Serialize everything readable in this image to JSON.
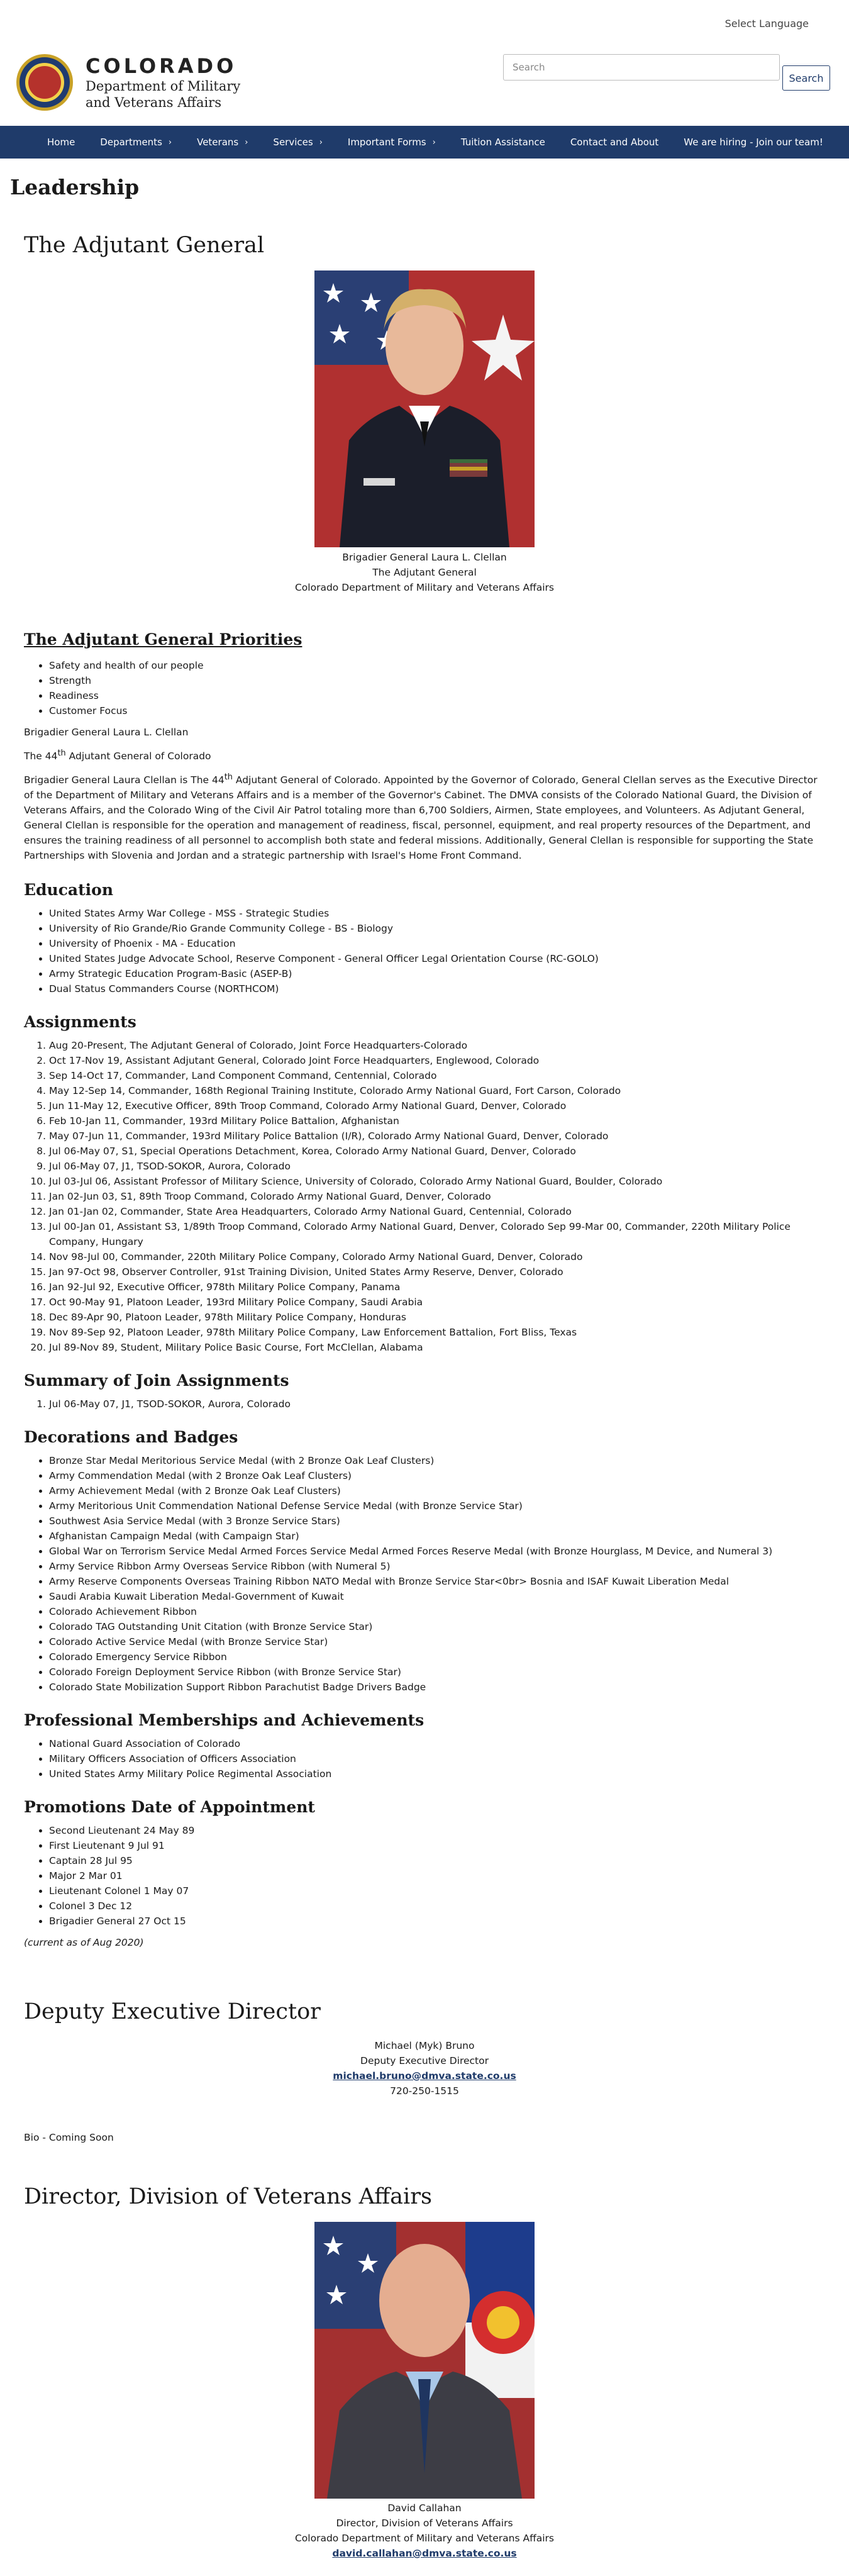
{
  "top": {
    "language": "Select Language"
  },
  "header": {
    "state": "COLORADO",
    "dept_line1": "Department of Military",
    "dept_line2": "and Veterans Affairs",
    "search_placeholder": "Search",
    "search_button": "Search"
  },
  "nav": [
    {
      "label": "Home",
      "chevron": false
    },
    {
      "label": "Departments",
      "chevron": true
    },
    {
      "label": "Veterans",
      "chevron": true
    },
    {
      "label": "Services",
      "chevron": true
    },
    {
      "label": "Important Forms",
      "chevron": true
    },
    {
      "label": "Tuition Assistance",
      "chevron": false
    },
    {
      "label": "Contact and About",
      "chevron": false
    },
    {
      "label": "We are hiring - Join our team!",
      "chevron": false
    }
  ],
  "page_title": "Leadership",
  "ag": {
    "section_title": "The Adjutant General",
    "caption": [
      "Brigadier General Laura L. Clellan",
      "The Adjutant General",
      "Colorado Department of Military and Veterans Affairs"
    ],
    "priorities_title": "The Adjutant General Priorities",
    "priorities": [
      "Safety and health of our people",
      "Strength",
      "Readiness",
      "Customer Focus"
    ],
    "name_line": "Brigadier General Laura L. Clellan",
    "title_line_pre": "The 44",
    "title_line_sup": "th",
    "title_line_post": " Adjutant General of Colorado",
    "bio_pre": "Brigadier General Laura Clellan is The 44",
    "bio_sup": "th",
    "bio_post": " Adjutant General of Colorado. Appointed by the Governor of Colorado, General Clellan serves as the Executive Director of the Department of Military and Veterans Affairs and is a member of the Governor's Cabinet. The DMVA consists of the Colorado National Guard, the Division of Veterans Affairs, and the Colorado Wing of the Civil Air Patrol totaling more than 6,700 Soldiers, Airmen, State employees, and Volunteers. As Adjutant General, General Clellan is responsible for the operation and management of readiness, fiscal, personnel, equipment, and real property resources of the Department, and ensures the training readiness of all personnel to accomplish both state and federal missions. Additionally, General Clellan is responsible for supporting the State Partnerships with Slovenia and Jordan and a strategic partnership with Israel's Home Front Command.",
    "education_title": "Education",
    "education": [
      "United States Army War College - MSS - Strategic Studies",
      "University of Rio Grande/Rio Grande Community College - BS - Biology",
      "University of Phoenix - MA - Education",
      "United States Judge Advocate School, Reserve Component - General Officer Legal Orientation Course (RC-GOLO)",
      "Army Strategic Education Program-Basic (ASEP-B)",
      "Dual Status Commanders Course (NORTHCOM)"
    ],
    "assignments_title": "Assignments",
    "assignments": [
      "Aug 20-Present, The Adjutant General of Colorado, Joint Force Headquarters-Colorado",
      "Oct 17-Nov 19, Assistant Adjutant General, Colorado Joint Force Headquarters, Englewood, Colorado",
      "Sep 14-Oct 17, Commander, Land Component Command, Centennial, Colorado",
      "May 12-Sep 14, Commander, 168th Regional Training Institute, Colorado Army National Guard, Fort Carson, Colorado",
      "Jun 11-May 12, Executive Officer, 89th Troop Command, Colorado Army National Guard, Denver, Colorado",
      "Feb 10-Jan 11, Commander, 193rd Military Police Battalion, Afghanistan",
      "May 07-Jun 11, Commander, 193rd Military Police Battalion (I/R), Colorado Army National Guard, Denver, Colorado",
      "Jul 06-May 07, S1, Special Operations Detachment, Korea, Colorado Army National Guard, Denver, Colorado",
      "Jul 06-May 07, J1, TSOD-SOKOR, Aurora, Colorado",
      "Jul 03-Jul 06, Assistant Professor of Military Science, University of Colorado, Colorado Army National Guard, Boulder, Colorado",
      "Jan 02-Jun 03, S1, 89th Troop Command, Colorado Army National Guard, Denver, Colorado",
      "Jan 01-Jan 02, Commander, State Area Headquarters, Colorado Army National Guard, Centennial, Colorado",
      "Jul 00-Jan 01, Assistant S3, 1/89th Troop Command, Colorado Army National Guard, Denver, Colorado Sep 99-Mar 00, Commander, 220th Military Police Company, Hungary",
      "Nov 98-Jul 00, Commander, 220th Military Police Company, Colorado Army National Guard, Denver, Colorado",
      "Jan 97-Oct 98, Observer Controller, 91st Training Division, United States Army Reserve, Denver, Colorado",
      "Jan 92-Jul 92, Executive Officer, 978th Military Police Company, Panama",
      "Oct 90-May 91, Platoon Leader, 193rd Military Police Company, Saudi Arabia",
      "Dec 89-Apr 90, Platoon Leader, 978th Military Police Company, Honduras",
      "Nov 89-Sep 92, Platoon Leader, 978th Military Police Company, Law Enforcement Battalion, Fort Bliss, Texas",
      "Jul 89-Nov 89, Student, Military Police Basic Course, Fort McClellan, Alabama"
    ],
    "joint_title": "Summary of Join Assignments",
    "joint": [
      "Jul 06-May 07, J1, TSOD-SOKOR, Aurora, Colorado"
    ],
    "decorations_title": "Decorations and Badges",
    "decorations": [
      "Bronze Star Medal Meritorious Service Medal (with 2 Bronze Oak Leaf Clusters)",
      "Army Commendation Medal (with 2 Bronze Oak Leaf Clusters)",
      "Army Achievement Medal (with 2 Bronze Oak Leaf Clusters)",
      "Army Meritorious Unit Commendation National Defense Service Medal (with Bronze Service Star)",
      "Southwest Asia Service Medal (with 3 Bronze Service Stars)",
      "Afghanistan Campaign Medal (with Campaign Star)",
      "Global War on Terrorism Service Medal Armed Forces Service Medal Armed Forces Reserve Medal (with Bronze Hourglass, M Device, and Numeral 3)",
      "Army Service Ribbon Army Overseas Service Ribbon (with Numeral 5)",
      "Army Reserve Components Overseas Training Ribbon NATO Medal with Bronze Service Star<0br> Bosnia and ISAF Kuwait Liberation Medal",
      "Saudi Arabia Kuwait Liberation Medal-Government of Kuwait",
      "Colorado Achievement Ribbon",
      "Colorado TAG Outstanding Unit Citation (with Bronze Service Star)",
      "Colorado Active Service Medal (with Bronze Service Star)",
      "Colorado Emergency Service Ribbon",
      "Colorado Foreign Deployment Service Ribbon (with Bronze Service Star)",
      "Colorado State Mobilization Support Ribbon Parachutist Badge Drivers Badge"
    ],
    "memberships_title": "Professional Memberships and Achievements",
    "memberships": [
      "National Guard Association of Colorado",
      "Military Officers Association of Officers Association",
      "United States Army Military Police Regimental Association"
    ],
    "promotions_title": "Promotions Date of Appointment",
    "promotions": [
      "Second Lieutenant 24 May 89",
      "First Lieutenant 9 Jul 91",
      "Captain 28 Jul 95",
      "Major 2 Mar 01",
      "Lieutenant Colonel 1 May 07",
      "Colonel 3 Dec 12",
      "Brigadier General 27 Oct 15"
    ],
    "current_note": "(current as of Aug 2020)"
  },
  "ded": {
    "section_title": "Deputy Executive Director",
    "name": "Michael (Myk) Bruno",
    "title": "Deputy Executive Director",
    "email": "michael.bruno@dmva.state.co.us",
    "phone": "720-250-1515",
    "bio": "Bio - Coming Soon"
  },
  "dva": {
    "section_title": "Director, Division of Veterans Affairs",
    "caption": [
      "David Callahan",
      "Director, Division of Veterans Affairs",
      "Colorado Department of Military and Veterans Affairs"
    ],
    "email": "david.callahan@dmva.state.co.us"
  },
  "colors": {
    "nav_bg": "#1f3b6a",
    "link": "#1f3b6a"
  }
}
